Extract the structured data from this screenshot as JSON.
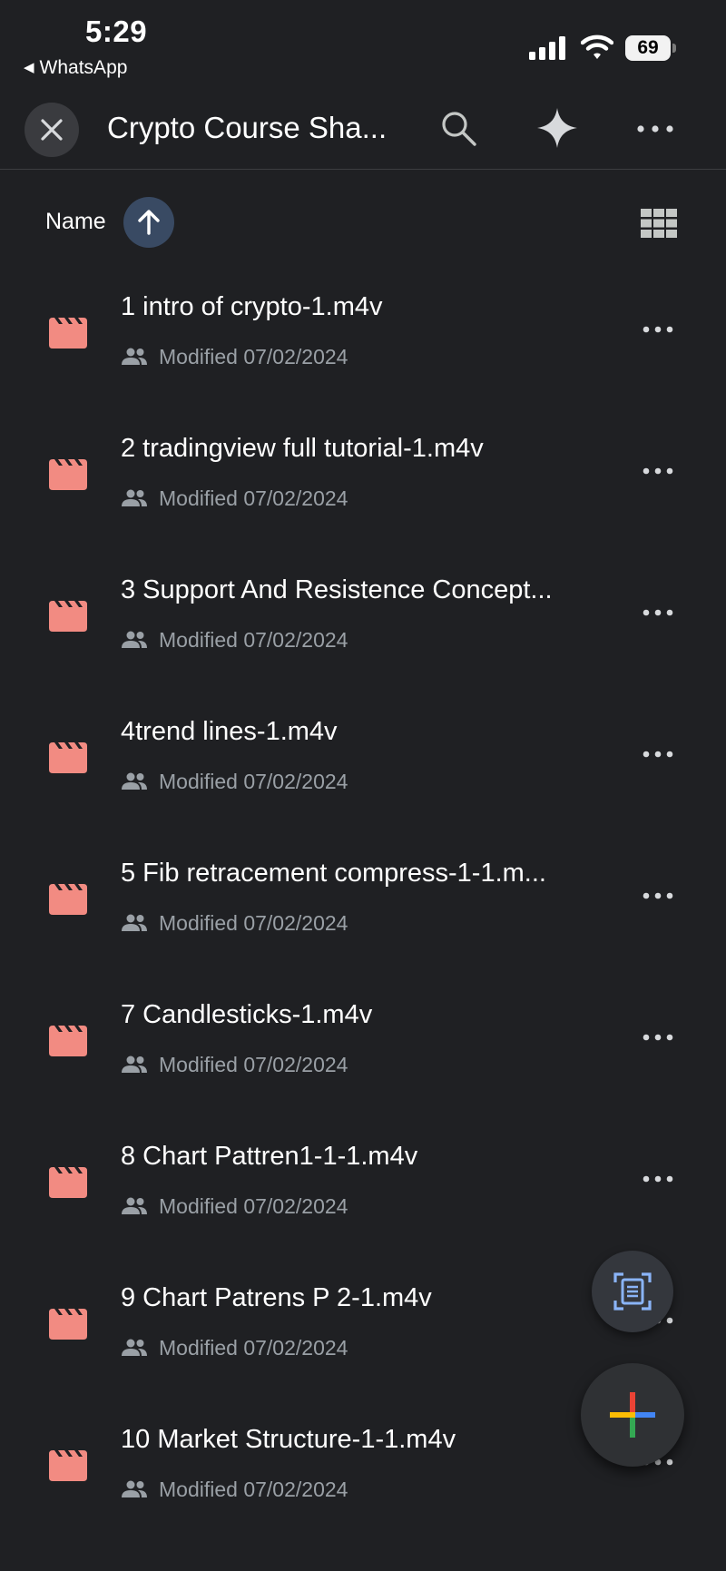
{
  "status_bar": {
    "time": "5:29",
    "back_app": "WhatsApp",
    "battery": "69"
  },
  "app_bar": {
    "title": "Crypto Course Sha..."
  },
  "sort": {
    "label": "Name"
  },
  "files": [
    {
      "name": "1 intro of crypto-1.m4v",
      "modified": "Modified 07/02/2024"
    },
    {
      "name": "2 tradingview full tutorial-1.m4v",
      "modified": "Modified 07/02/2024"
    },
    {
      "name": "3 Support And Resistence Concept...",
      "modified": "Modified 07/02/2024"
    },
    {
      "name": "4trend lines-1.m4v",
      "modified": "Modified 07/02/2024"
    },
    {
      "name": "5 Fib retracement compress-1-1.m...",
      "modified": "Modified 07/02/2024"
    },
    {
      "name": "7 Candlesticks-1.m4v",
      "modified": "Modified 07/02/2024"
    },
    {
      "name": "8 Chart Pattren1-1-1.m4v",
      "modified": "Modified 07/02/2024"
    },
    {
      "name": "9 Chart Patrens P 2-1.m4v",
      "modified": "Modified 07/02/2024"
    },
    {
      "name": "10 Market Structure-1-1.m4v",
      "modified": "Modified 07/02/2024"
    }
  ],
  "icons": {
    "file_type": "video-file-icon",
    "shared": "shared-people-icon"
  },
  "colors": {
    "background": "#1f2023",
    "video_icon": "#f28b82",
    "secondary_text": "#9aa0a6",
    "sort_button": "#394a63"
  }
}
